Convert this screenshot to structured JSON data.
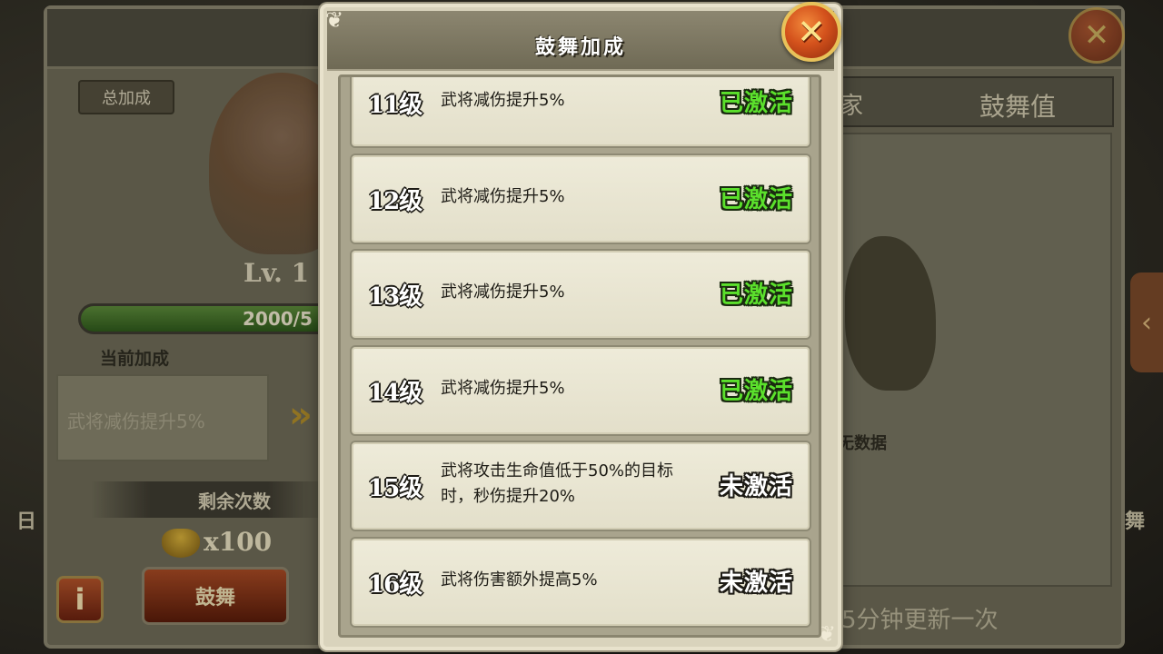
{
  "background": {
    "total_bonus_tag": "总加成",
    "level_text": "Lv. 1",
    "progress_text": "2000/5",
    "progress_fraction": 1.0,
    "current_bonus_label": "当前加成",
    "current_bonus_value": "武将减伤提升5%",
    "arrows": "»",
    "remaining_label": "剩余次数",
    "cost_text": "x100",
    "info_label": "i",
    "inspire_button": "鼓舞",
    "tab_home": "家",
    "tab_inspire_value": "鼓舞值",
    "no_data": "无数据",
    "update_note": "5分钟更新一次",
    "side_left": "日",
    "side_right": "舞",
    "right_arrow": "‹",
    "close_glyph": "✕"
  },
  "modal": {
    "title": "鼓舞加成",
    "close_glyph": "✕",
    "corner_glyph": "❦"
  },
  "bonus_rows": [
    {
      "level": "11级",
      "description": "武将减伤提升5%",
      "status": "已激活",
      "active": true
    },
    {
      "level": "12级",
      "description": "武将减伤提升5%",
      "status": "已激活",
      "active": true
    },
    {
      "level": "13级",
      "description": "武将减伤提升5%",
      "status": "已激活",
      "active": true
    },
    {
      "level": "14级",
      "description": "武将减伤提升5%",
      "status": "已激活",
      "active": true
    },
    {
      "level": "15级",
      "description": "武将攻击生命值低于50%的目标时，秒伤提升20%",
      "status": "未激活",
      "active": false
    },
    {
      "level": "16级",
      "description": "武将伤害额外提高5%",
      "status": "未激活",
      "active": false
    }
  ],
  "colors": {
    "active_status": "#5be02c",
    "inactive_status": "#ffffff",
    "close_button": "#d4521c"
  }
}
